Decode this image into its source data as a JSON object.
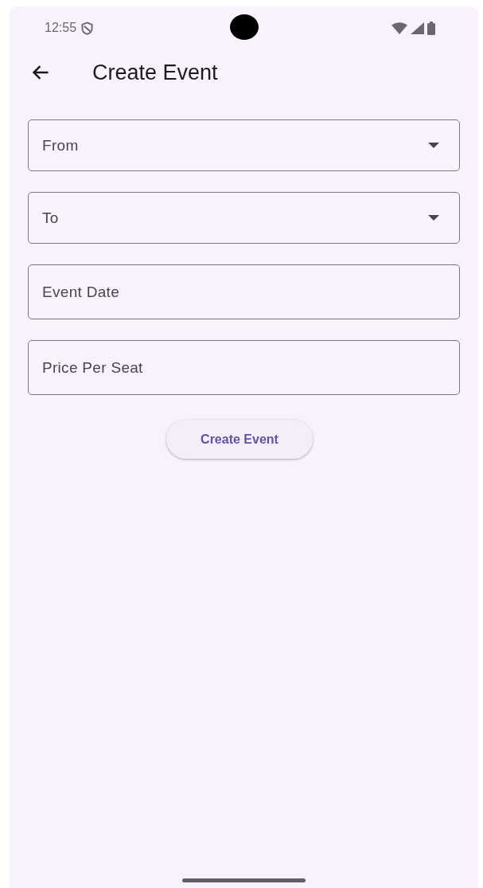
{
  "status_bar": {
    "time": "12:55"
  },
  "app_bar": {
    "title": "Create Event"
  },
  "fields": [
    {
      "kind": "dropdown",
      "placeholder": "From"
    },
    {
      "kind": "dropdown",
      "placeholder": "To"
    },
    {
      "kind": "text",
      "placeholder": "Event Date"
    },
    {
      "kind": "text",
      "placeholder": "Price Per Seat"
    }
  ],
  "button": {
    "label": "Create Event"
  }
}
